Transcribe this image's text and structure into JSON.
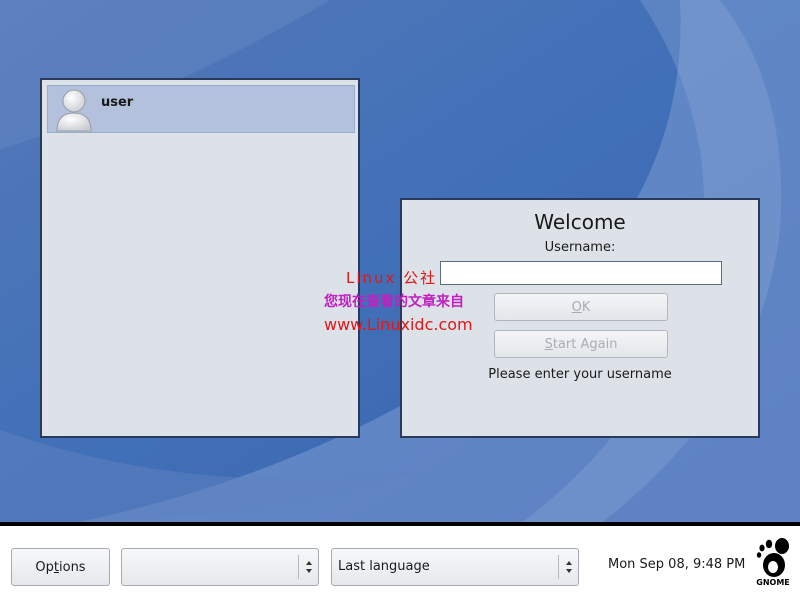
{
  "colors": {
    "desktop_blue": "#3f6cb3",
    "panel_bg": "#dde1e8",
    "selected_row": "#b3c1dc",
    "watermark_red": "#e01818",
    "watermark_magenta": "#c020c0"
  },
  "user_list": {
    "users": [
      {
        "name": "user",
        "icon": "user-avatar-icon",
        "selected": true
      }
    ]
  },
  "login": {
    "title": "Welcome",
    "username_label": "Username:",
    "username_value": "",
    "ok_mnemonic": "O",
    "ok_rest": "K",
    "start_again_mnemonic": "S",
    "start_again_rest": "tart Again",
    "hint": "Please enter your username"
  },
  "watermark": {
    "line1": "Linux 公社",
    "line2": "您现在查看的文章来自",
    "line3": "www.Linuxidc.com"
  },
  "bottom_panel": {
    "options_pre": "Op",
    "options_mnemonic": "t",
    "options_post": "ions",
    "session_value": "",
    "language_value": "Last language",
    "clock": "Mon Sep 08,  9:48 PM",
    "logo_text": "GNOME",
    "logo_icon": "gnome-foot-icon"
  }
}
